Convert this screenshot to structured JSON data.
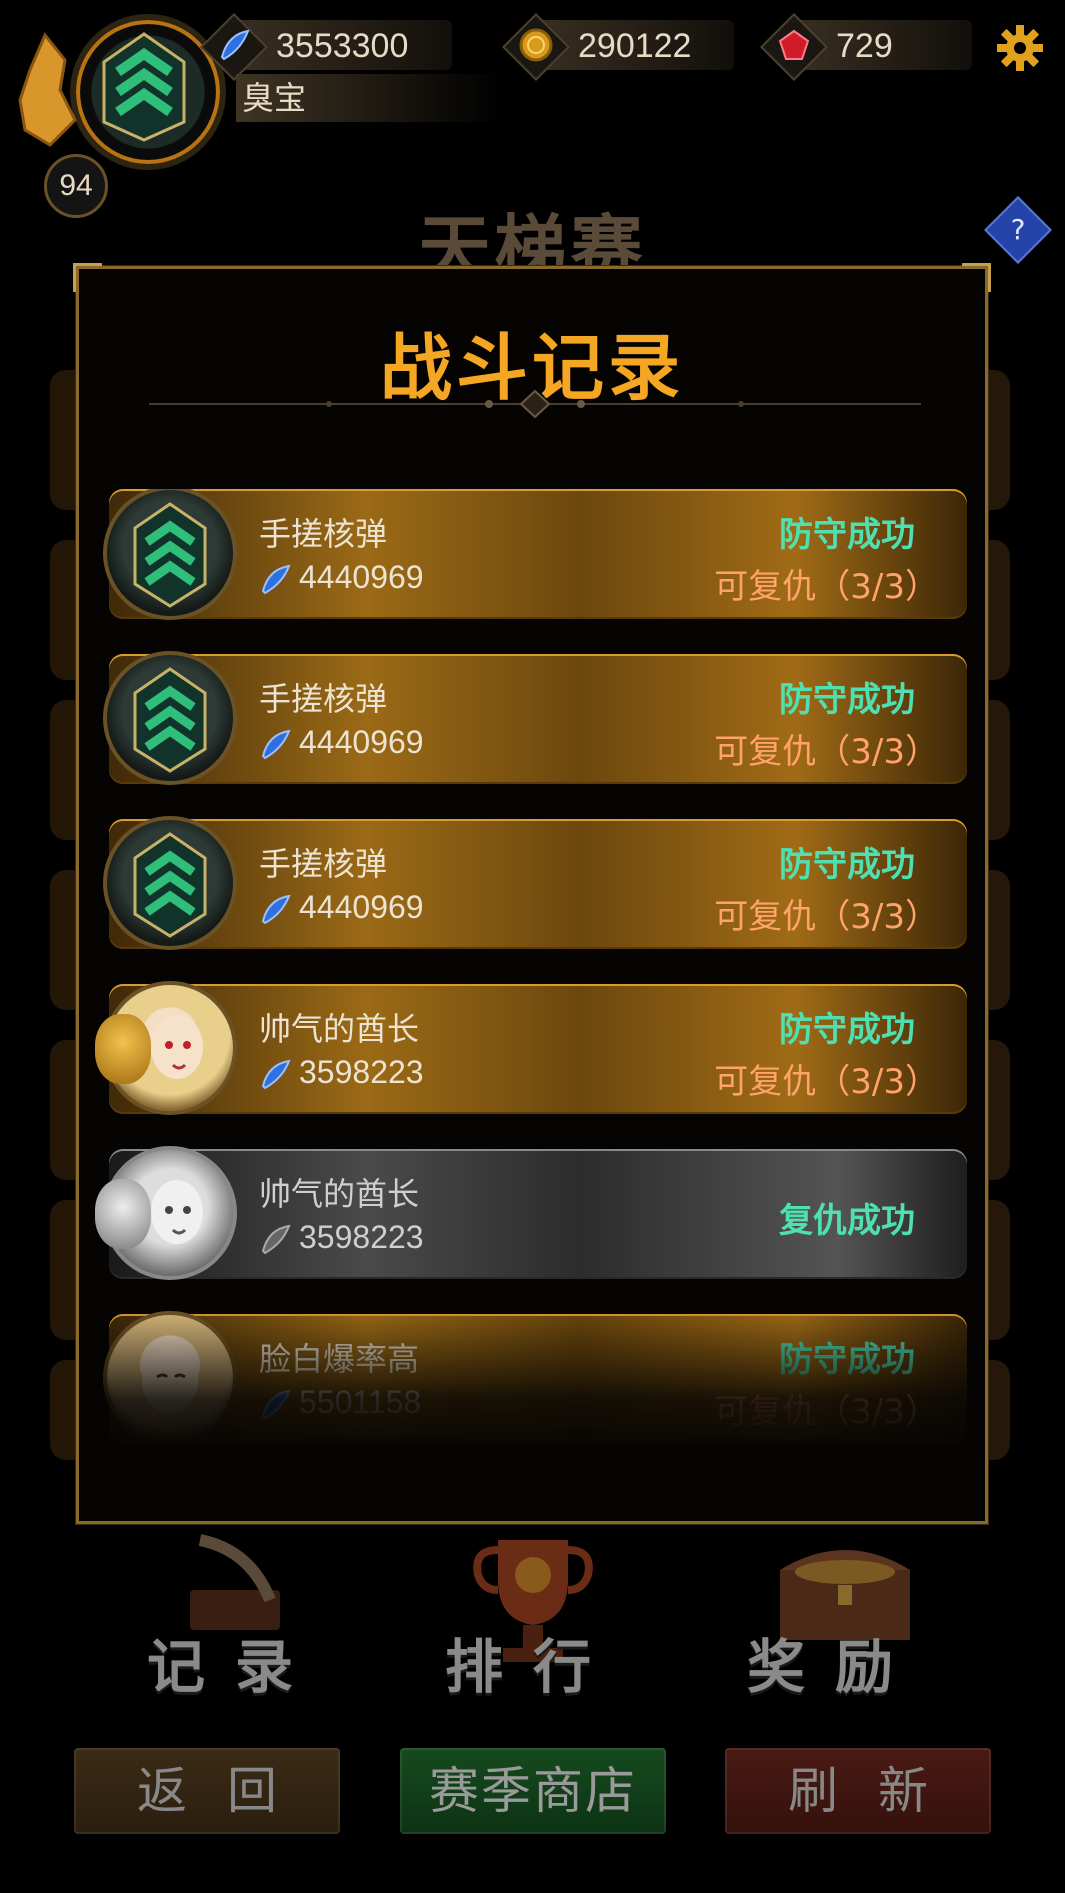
{
  "header": {
    "level": "94",
    "player_name": "臭宝",
    "resources": [
      {
        "icon": "feather-power-icon",
        "value": "3553300"
      },
      {
        "icon": "gold-coin-icon",
        "value": "290122"
      },
      {
        "icon": "red-gem-icon",
        "value": "729"
      }
    ],
    "help_label": "?"
  },
  "page_title": "天梯赛",
  "dialog": {
    "title": "战斗记录",
    "records": [
      {
        "name": "手搓核弹",
        "power": "4440969",
        "status": "防守成功",
        "revenge": "可复仇（3/3）"
      },
      {
        "name": "手搓核弹",
        "power": "4440969",
        "status": "防守成功",
        "revenge": "可复仇（3/3）"
      },
      {
        "name": "手搓核弹",
        "power": "4440969",
        "status": "防守成功",
        "revenge": "可复仇（3/3）"
      },
      {
        "name": "帅气的酋长",
        "power": "3598223",
        "status": "防守成功",
        "revenge": "可复仇（3/3）"
      },
      {
        "name": "帅气的酋长",
        "power": "3598223",
        "status": "复仇成功",
        "revenge": ""
      },
      {
        "name": "脸白爆率高",
        "power": "5501158",
        "status": "防守成功",
        "revenge": "可复仇（3/3）"
      }
    ]
  },
  "nav": {
    "record": "记录",
    "rank": "排行",
    "reward": "奖励"
  },
  "buttons": {
    "back": "返回",
    "shop": "赛季商店",
    "refresh": "刷新"
  },
  "colors": {
    "title": "#f5a623",
    "status": "#4fe0b2",
    "revenge": "#ffa36a"
  }
}
